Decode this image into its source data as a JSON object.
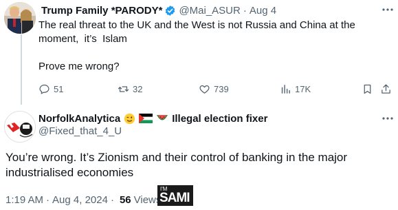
{
  "tweet1": {
    "display_name": "Trump Family *PARODY*",
    "handle": "@Mai_ASUR",
    "date": "Aug 4",
    "text_lines": [
      "The real threat to the UK and the West is not Russia and China at the",
      "moment,  it’s  Islam",
      "",
      "Prove me wrong?"
    ],
    "replies": "51",
    "reposts": "32",
    "likes": "739",
    "views": "17K",
    "icons": {
      "more": "more-icon",
      "verified": "verified-badge-icon",
      "reply": "reply-icon",
      "repost": "repost-icon",
      "like": "like-icon",
      "views": "views-icon",
      "bookmark": "bookmark-icon",
      "share": "share-icon"
    }
  },
  "tweet2": {
    "display_name": "NorfolkAnalytica",
    "name_suffix": "Illegal election fixer",
    "handle": "@Fixed_that_4_U",
    "text": "You’re wrong. It’s Zionism and their control of banking in the major industrialised economies",
    "time": "1:19 AM",
    "date": "Aug 4, 2024",
    "views_count": "56",
    "views_label": "Views",
    "badge_im": "I'M",
    "badge_name": "SAMI",
    "emojis": [
      "winking-face-icon",
      "palestine-flag-icon",
      "watermelon-icon"
    ]
  },
  "colors": {
    "text": "#0f1419",
    "muted": "#536471",
    "verified": "#1d9bf0",
    "thread_line": "#cfd9de"
  }
}
